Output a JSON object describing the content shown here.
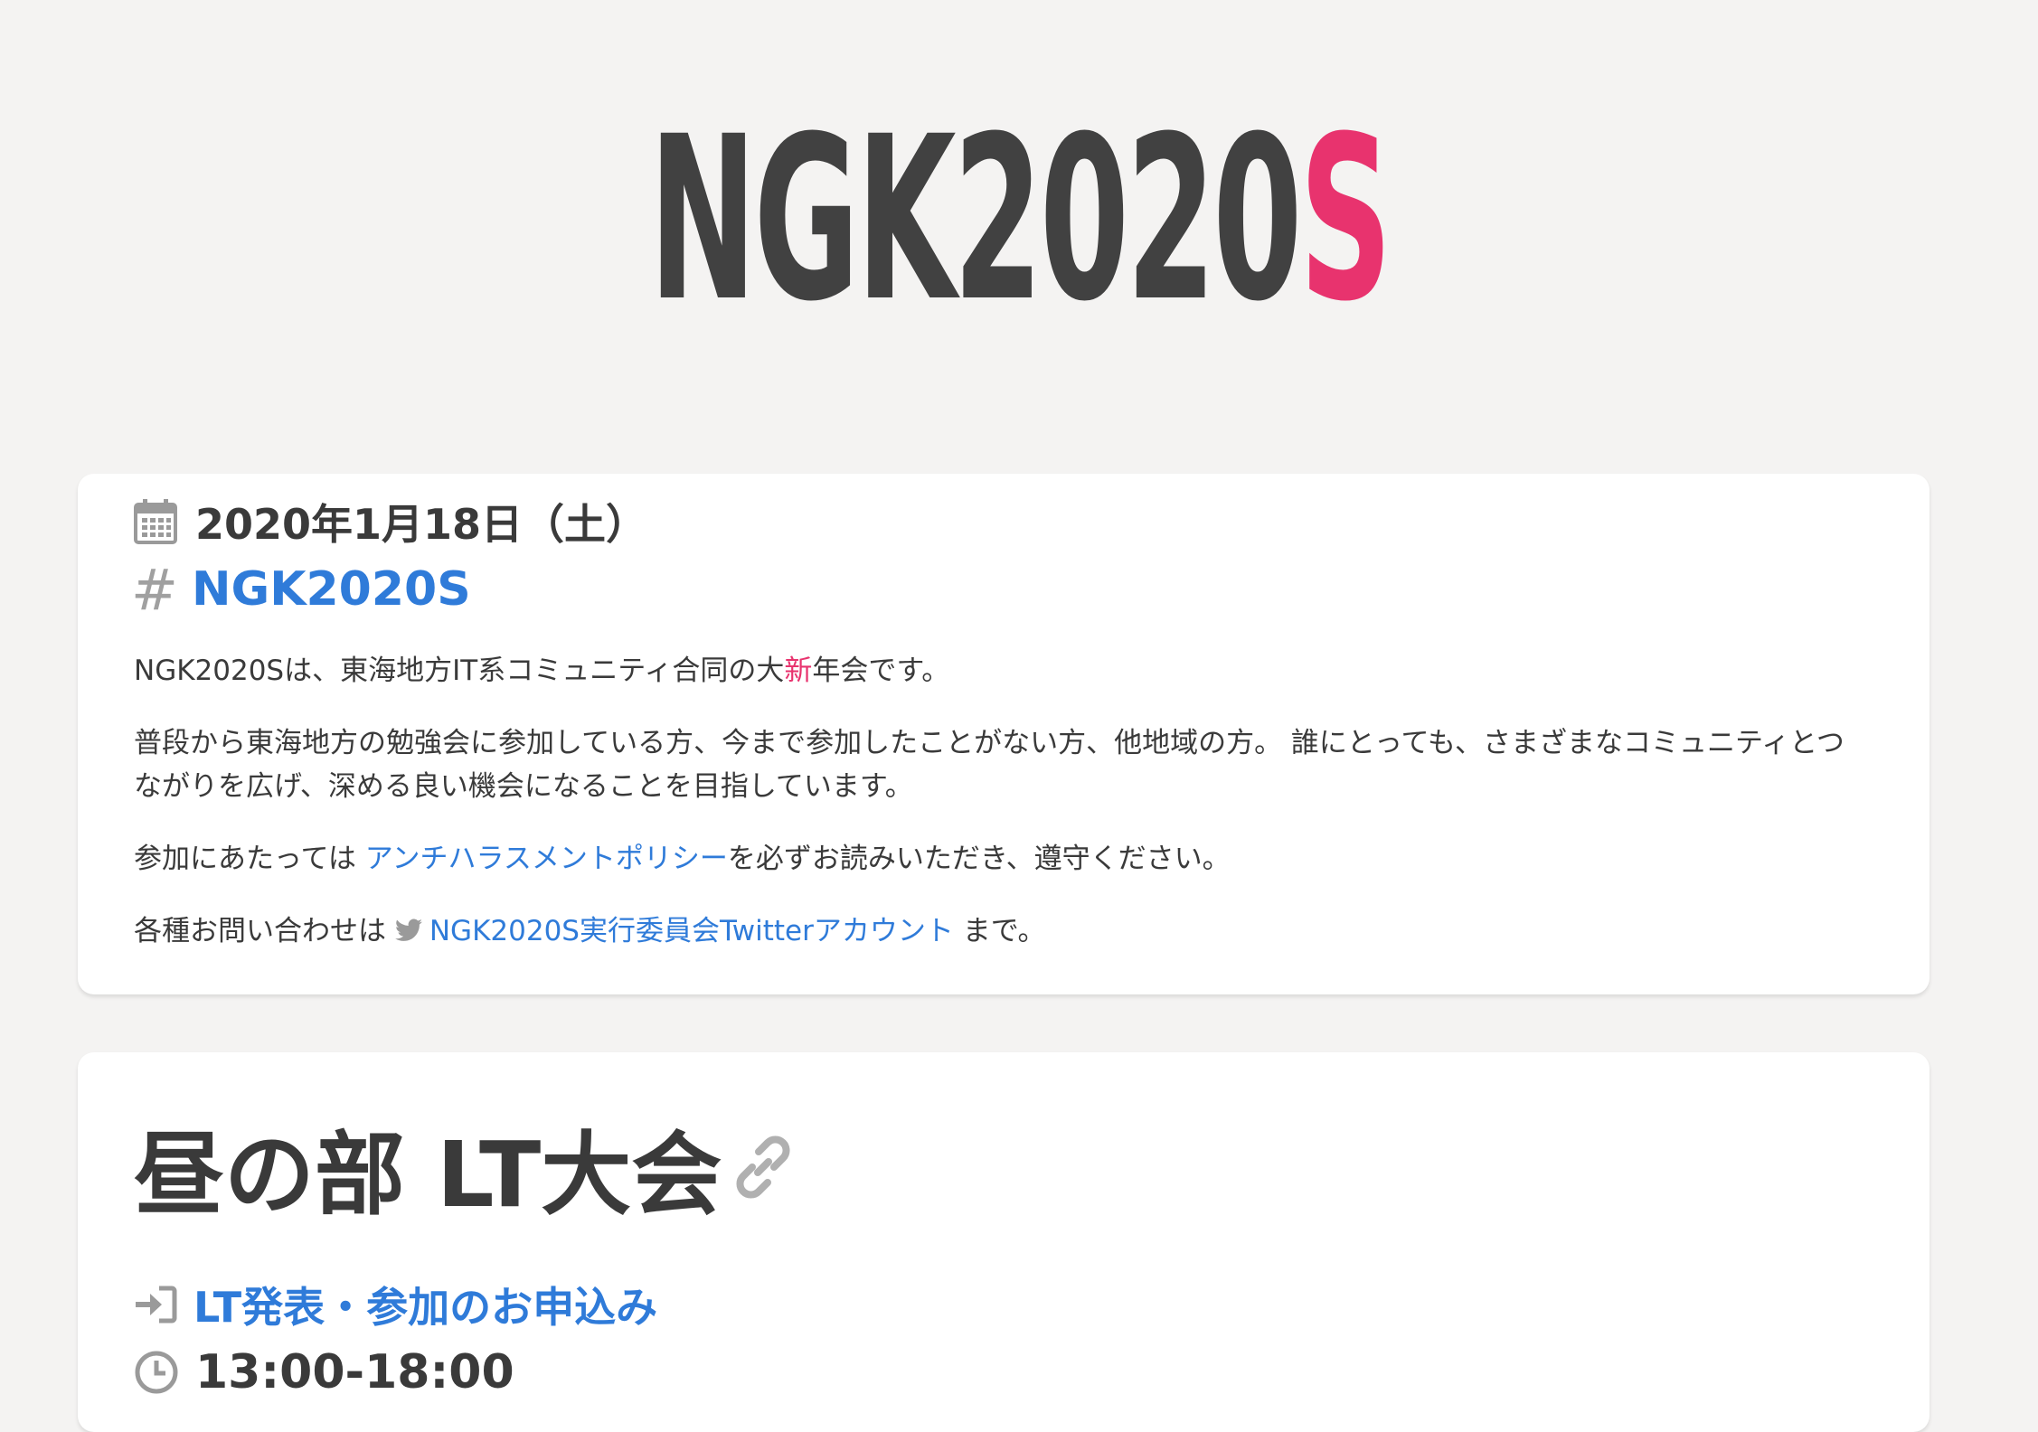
{
  "header": {
    "logo_main": "NGK2020",
    "logo_accent": "S",
    "accent_color": "#e8336e"
  },
  "event_card": {
    "date_icon": "calendar-icon",
    "date": "2020年1月18日（土）",
    "hashtag_icon": "hash-icon",
    "hashtag": "NGK2020S",
    "intro_pre": "NGK2020Sは、東海地方IT系コミュニティ合同の大",
    "intro_highlight": "新",
    "intro_post": "年会です。",
    "description": "普段から東海地方の勉強会に参加している方、今まで参加したことがない方、他地域の方。 誰にとっても、さまざまなコミュニティとつながりを広げ、深める良い機会になることを目指しています。",
    "policy_pre": "参加にあたっては ",
    "policy_link": "アンチハラスメントポリシー",
    "policy_post": "を必ずお読みいただき、遵守ください。",
    "contact_pre": "各種お問い合わせは ",
    "contact_icon": "twitter-icon",
    "contact_link": "NGK2020S実行委員会Twitterアカウント",
    "contact_post": " まで。"
  },
  "lt_section": {
    "title": "昼の部 LT大会",
    "anchor_icon": "link-icon",
    "apply_icon": "sign-in-icon",
    "apply_link": "LT発表・参加のお申込み",
    "time_icon": "clock-icon",
    "time": "13:00-18:00"
  },
  "colors": {
    "background": "#f4f3f2",
    "link": "#2f7bd9",
    "text": "#3a3a3a"
  }
}
